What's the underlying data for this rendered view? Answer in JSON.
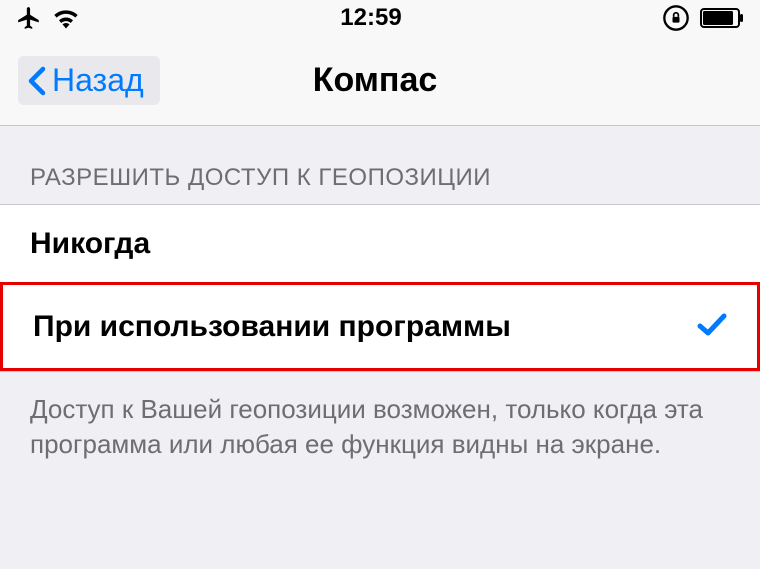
{
  "status": {
    "time": "12:59"
  },
  "nav": {
    "back_label": "Назад",
    "title": "Компас"
  },
  "section": {
    "header": "РАЗРЕШИТЬ ДОСТУП К ГЕОПОЗИЦИИ",
    "options": [
      {
        "label": "Никогда",
        "selected": false
      },
      {
        "label": "При использовании программы",
        "selected": true
      }
    ],
    "footer": "Доступ к Вашей геопозиции возможен, только когда эта программа или любая ее функция видны на экране."
  }
}
